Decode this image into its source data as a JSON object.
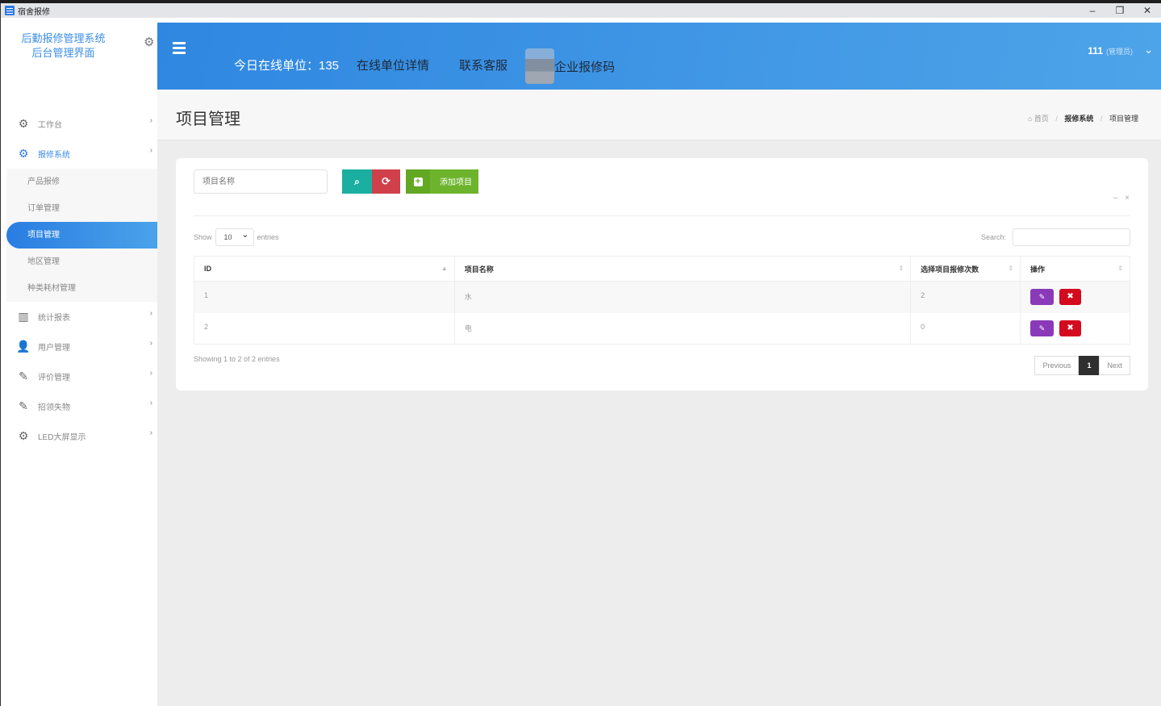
{
  "window": {
    "title": "宿舍报修",
    "controls": {
      "minimize": "–",
      "restore": "❐",
      "close": "✕"
    }
  },
  "brand": {
    "line1": "后勤报修管理系统",
    "line2": "后台管理界面",
    "settings_icon": "⚙"
  },
  "sidebar": {
    "items": [
      {
        "label": "工作台",
        "icon": "cogs-icon",
        "glyph": "⚙",
        "chevron": "›"
      },
      {
        "label": "报修系统",
        "icon": "cogs-icon",
        "glyph": "⚙",
        "chevron": "›",
        "active": true
      },
      {
        "label": "统计报表",
        "icon": "bar-chart-icon",
        "glyph": "▥",
        "chevron": "›"
      },
      {
        "label": "用户管理",
        "icon": "user-icon",
        "glyph": "👤",
        "chevron": "›"
      },
      {
        "label": "评价管理",
        "icon": "edit-icon",
        "glyph": "✎",
        "chevron": "›"
      },
      {
        "label": "招领失物",
        "icon": "edit-icon",
        "glyph": "✎",
        "chevron": "›"
      },
      {
        "label": "LED大屏显示",
        "icon": "cogs-icon",
        "glyph": "⚙",
        "chevron": "›"
      }
    ],
    "subitems": [
      {
        "label": "产品报修"
      },
      {
        "label": "订单管理"
      },
      {
        "label": "项目管理",
        "selected": true
      },
      {
        "label": "地区管理"
      },
      {
        "label": "种类耗材管理"
      }
    ]
  },
  "topbar": {
    "online_label": "今日在线单位：135",
    "links": [
      "在线单位详情",
      "联系客服"
    ],
    "qr_label": "企业报修码",
    "user_name": "111",
    "user_role": "(管理员)",
    "chevron": "⌄"
  },
  "page": {
    "title": "项目管理",
    "breadcrumb": {
      "home_icon": "⌂",
      "home": "首页",
      "parent": "报修系统",
      "current": "项目管理",
      "sep": "/"
    }
  },
  "toolbar": {
    "search_placeholder": "项目名称",
    "search_icon": "⌕",
    "refresh_icon": "⟳",
    "add_label": "添加项目",
    "add_icon": "+",
    "collapse": "–",
    "close": "×"
  },
  "table": {
    "length_prefix": "Show",
    "length_value": "10",
    "length_suffix": "entries",
    "search_label": "Search:",
    "search_value": "",
    "columns": [
      "ID",
      "项目名称",
      "选择项目报修次数",
      "操作"
    ],
    "sort_icons": [
      "▲",
      "⇕",
      "⇕",
      "⇕"
    ],
    "rows": [
      {
        "id": "1",
        "name": "水",
        "count": "2"
      },
      {
        "id": "2",
        "name": "电",
        "count": "0"
      }
    ],
    "edit_icon": "✎",
    "delete_icon": "✖",
    "info": "Showing 1 to 2 of 2 entries",
    "pager": {
      "previous": "Previous",
      "page": "1",
      "next": "Next"
    }
  }
}
